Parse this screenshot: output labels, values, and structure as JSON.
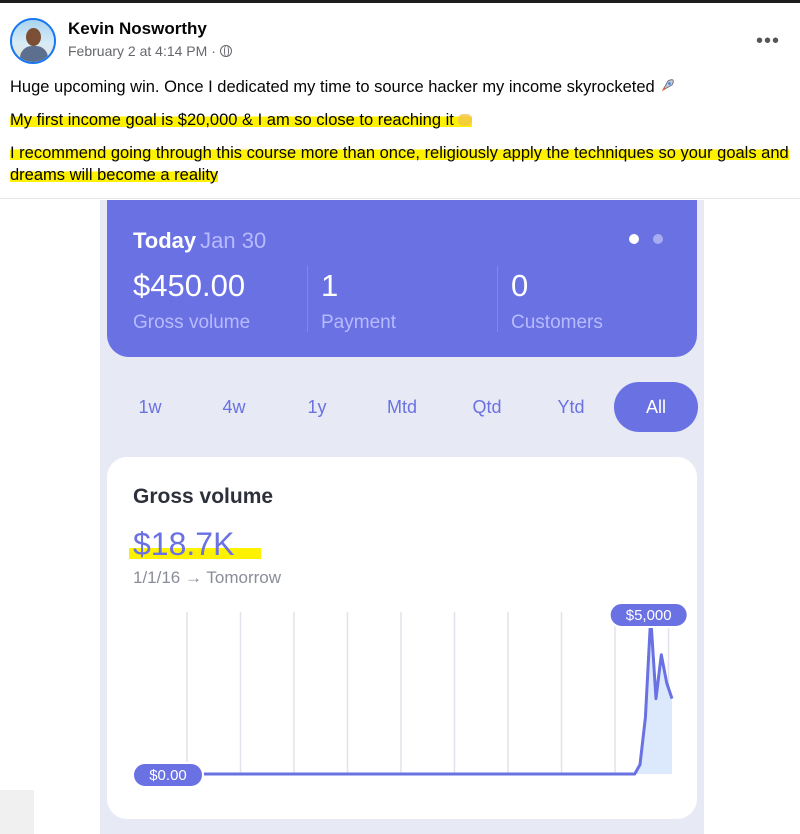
{
  "post": {
    "author": "Kevin Nosworthy",
    "timestamp": "February 2 at 4:14 PM",
    "separator": "·",
    "privacy_icon": "globe-icon",
    "more_icon": "more-options-icon",
    "more_label": "•••",
    "lines": [
      "Huge upcoming win. Once I dedicated my time to source hacker my income skyrocketed",
      "My first income goal is $20,000 & I am so close to reaching it",
      "I recommend going through this course more than once, religiously apply the techniques so your goals and dreams will become a reality"
    ],
    "highlight_color": "#fff200"
  },
  "dashboard": {
    "today": {
      "label": "Today",
      "date": "Jan 30",
      "stats": [
        {
          "value": "$450.00",
          "label": "Gross volume"
        },
        {
          "value": "1",
          "label": "Payment"
        },
        {
          "value": "0",
          "label": "Customers"
        }
      ],
      "pager_active": 0,
      "pager_count": 2
    },
    "ranges": [
      "1w",
      "4w",
      "1y",
      "Mtd",
      "Qtd",
      "Ytd",
      "All"
    ],
    "active_range": "All",
    "gross_volume": {
      "title": "Gross volume",
      "amount": "$18.7K",
      "period": "1/1/16 → Tomorrow",
      "max_label": "$5,000",
      "min_label": "$0.00"
    },
    "accent_color": "#6a71e3"
  },
  "chart_data": {
    "type": "area",
    "title": "Gross volume",
    "x_range": [
      "1/1/16",
      "Tomorrow"
    ],
    "ylim": [
      0,
      5000
    ],
    "series": [
      {
        "values": [
          0,
          0,
          0,
          0,
          0,
          40,
          0,
          0,
          0,
          0,
          0,
          0,
          0,
          0,
          0,
          0,
          0,
          0,
          0,
          0,
          0,
          0,
          0,
          0,
          0,
          0,
          0,
          0,
          0,
          0,
          0,
          0,
          0,
          0,
          0,
          0,
          0,
          0,
          0,
          0,
          0,
          0,
          0,
          0,
          0,
          0,
          0,
          0,
          0,
          0,
          0,
          0,
          0,
          0,
          0,
          0,
          0,
          0,
          0,
          0,
          0,
          0,
          0,
          0,
          0,
          0,
          0,
          0,
          0,
          0,
          0,
          0,
          0,
          0,
          0,
          0,
          0,
          0,
          0,
          0,
          0,
          0,
          0,
          0,
          0,
          0,
          0,
          0,
          0,
          0,
          0,
          0,
          0,
          0,
          300,
          1800,
          5000,
          2400,
          3800,
          2900,
          2400
        ]
      }
    ],
    "annotations": [
      "$5,000",
      "$0.00"
    ],
    "grid": "vertical"
  }
}
